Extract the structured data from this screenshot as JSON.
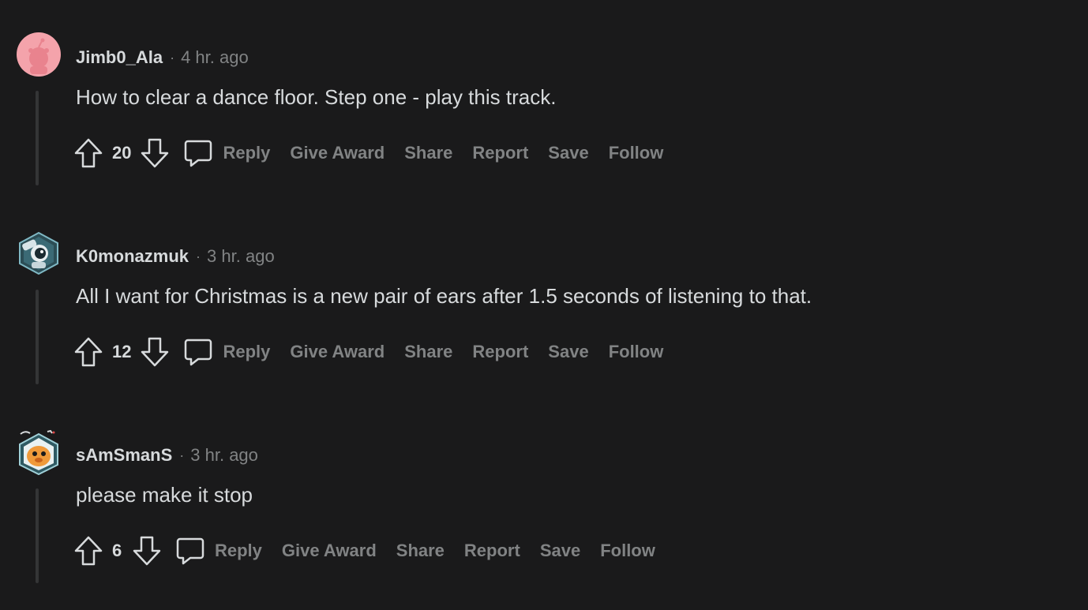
{
  "comments": [
    {
      "avatar_icon": "snoo-avatar-icon",
      "avatar_color": "#f3a0a8",
      "username": "Jimb0_Ala",
      "separator": "·",
      "timestamp": "4 hr. ago",
      "body": "How to clear a dance floor. Step one - play this track.",
      "score": "20",
      "actions": {
        "reply": "Reply",
        "give_award": "Give Award",
        "share": "Share",
        "report": "Report",
        "save": "Save",
        "follow": "Follow"
      }
    },
    {
      "avatar_icon": "astronaut-avatar-icon",
      "avatar_color": "#7fb8c4",
      "username": "K0monazmuk",
      "separator": "·",
      "timestamp": "3 hr. ago",
      "body": "All I want for Christmas is a new pair of ears after 1.5 seconds of listening to that.",
      "score": "12",
      "actions": {
        "reply": "Reply",
        "give_award": "Give Award",
        "share": "Share",
        "report": "Report",
        "save": "Save",
        "follow": "Follow"
      }
    },
    {
      "avatar_icon": "orange-character-avatar-icon",
      "avatar_color": "#f0a040",
      "username": "sAmSmanS",
      "separator": "·",
      "timestamp": "3 hr. ago",
      "body": "please make it stop",
      "score": "6",
      "actions": {
        "reply": "Reply",
        "give_award": "Give Award",
        "share": "Share",
        "report": "Report",
        "save": "Save",
        "follow": "Follow"
      }
    }
  ],
  "theme": {
    "background": "#1a1a1b",
    "text_primary": "#d7dadc",
    "text_muted": "#818384",
    "thread_line": "#343536"
  }
}
